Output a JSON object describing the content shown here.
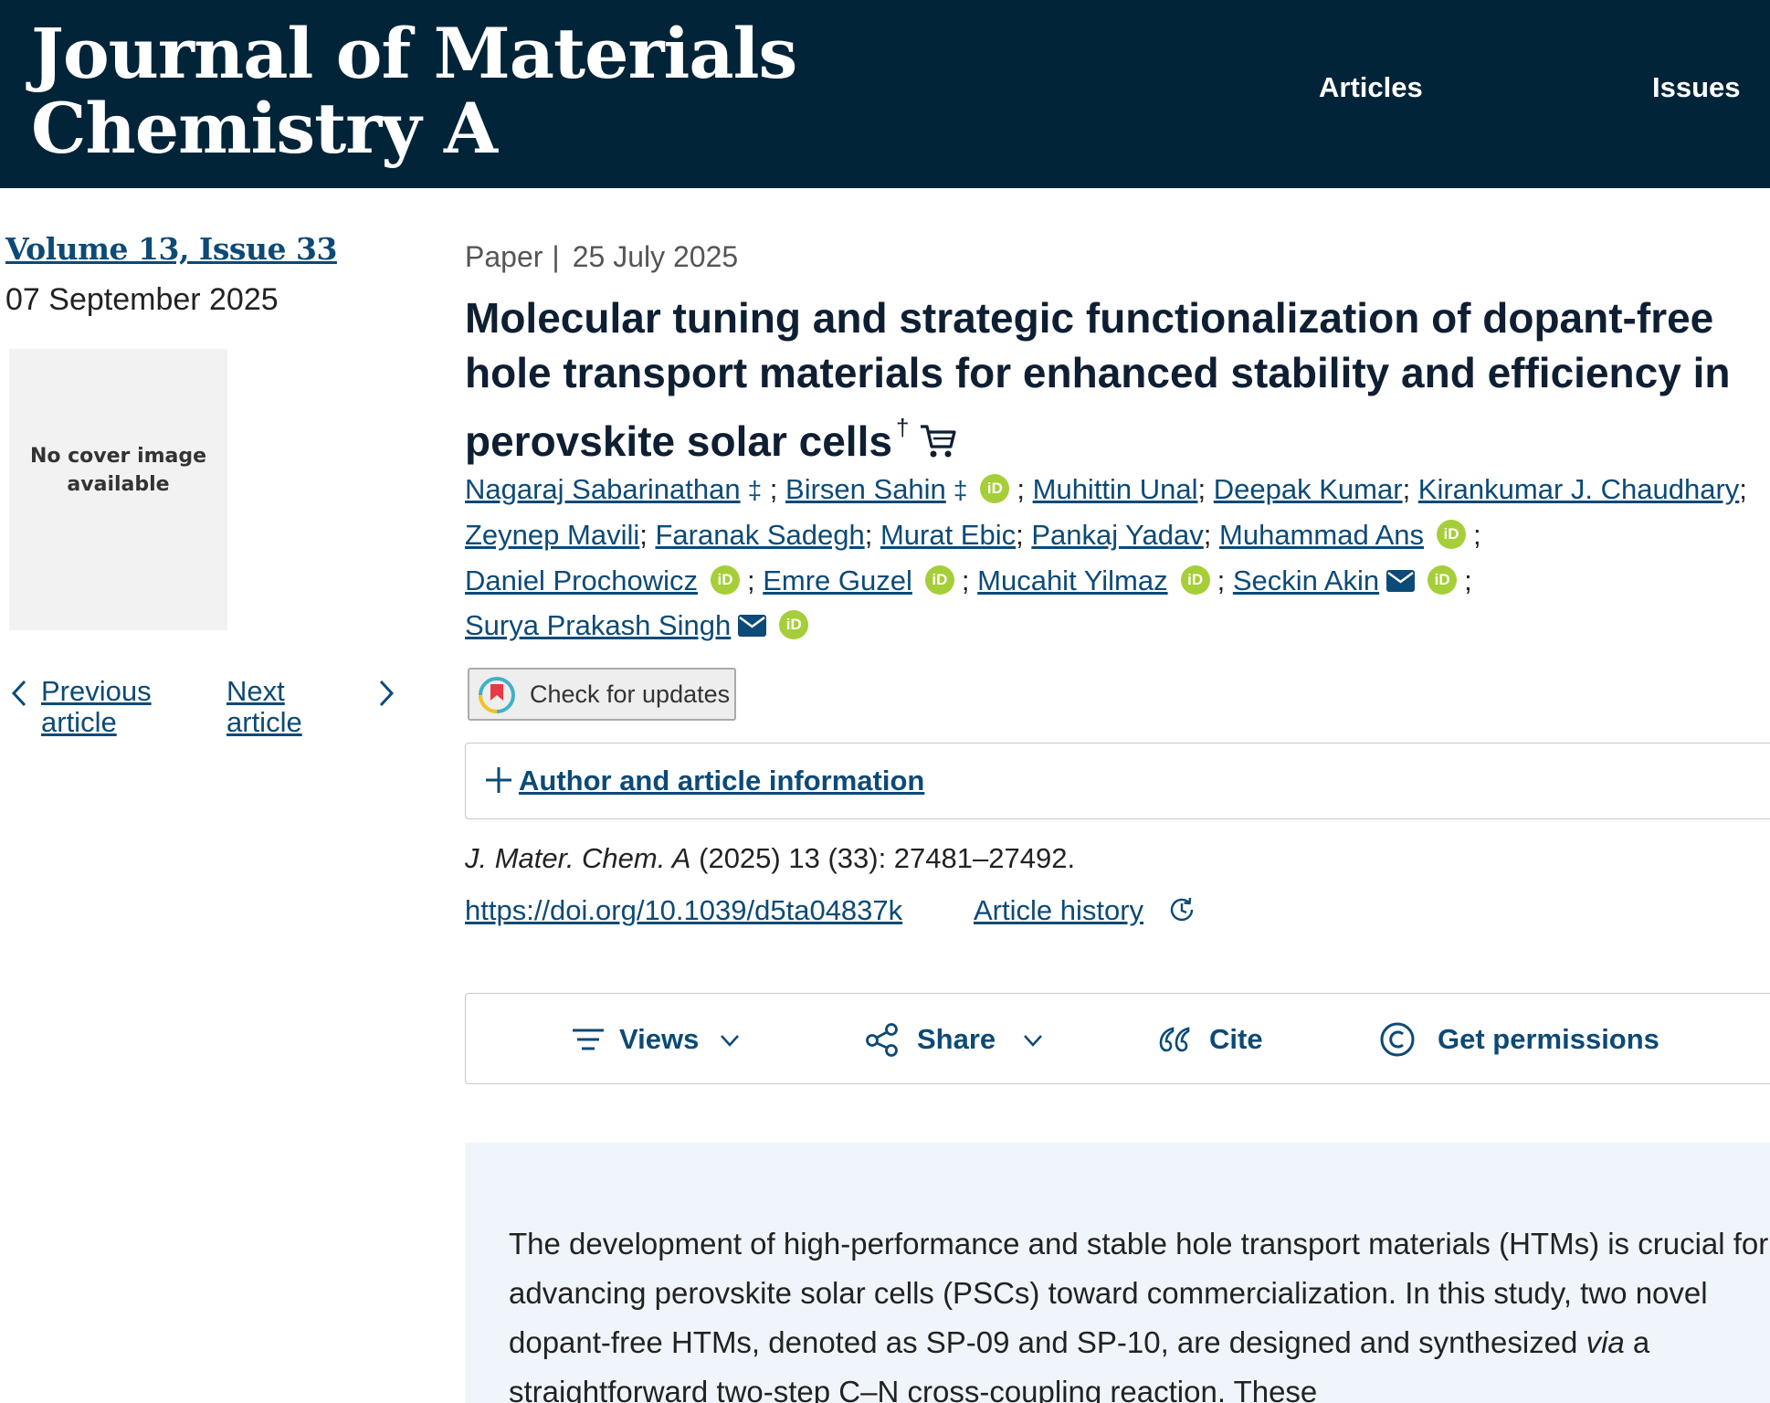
{
  "header": {
    "journal_title": "Journal of Materials Chemistry A",
    "nav": {
      "articles": "Articles",
      "issues": "Issues"
    },
    "background_color": "#022439"
  },
  "sidebar": {
    "volume_issue": "Volume 13, Issue 33",
    "issue_date": "07 September 2025",
    "cover_placeholder": "No cover image available",
    "previous_article": "Previous article",
    "next_article": "Next article"
  },
  "article": {
    "type": "Paper",
    "separator": "|",
    "published_date": "25 July 2025",
    "title": "Molecular tuning and strategic functionalization of dopant-free hole transport materials for enhanced stability and efficiency in perovskite solar cells",
    "title_footnote": "†",
    "authors": [
      "Nagaraj Sabarinathan",
      "Birsen Sahin",
      "Muhittin Unal",
      "Deepak Kumar",
      "Kirankumar J. Chaudhary",
      "Zeynep Mavili",
      "Faranak Sadegh",
      "Murat Ebic",
      "Pankaj Yadav",
      "Muhammad Ans",
      "Daniel Prochowicz",
      "Emre Guzel",
      "Mucahit Yilmaz",
      "Seckin Akin",
      "Surya Prakash Singh"
    ],
    "equal_contribution_mark": "‡",
    "orcid_label": "iD",
    "check_updates": "Check for updates",
    "author_info_toggle": "Author and article information",
    "citation": {
      "journal_abbrev": "J. Mater. Chem. A",
      "details": "(2025) 13 (33): 27481–27492."
    },
    "doi": "https://doi.org/10.1039/d5ta04837k",
    "article_history": "Article history"
  },
  "toolbar": {
    "views": "Views",
    "share": "Share",
    "cite": "Cite",
    "permissions": "Get permissions"
  },
  "abstract": {
    "text_before_via": "The development of high-performance and stable hole transport materials (HTMs) is crucial for advancing perovskite solar cells (PSCs) toward commercialization. In this study, two novel dopant-free HTMs, denoted as SP-09 and SP-10, are designed and synthesized ",
    "via": "via",
    "text_after_via": " a straightforward two-step C–N cross-coupling reaction. These"
  },
  "colors": {
    "link": "#0c4a77",
    "orcid": "#a6ce39",
    "abstract_bg": "#f0f5fb"
  }
}
